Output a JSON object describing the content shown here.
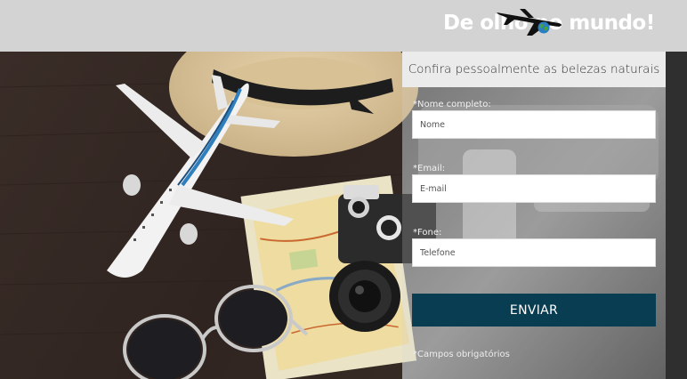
{
  "header": {
    "logo_text": "De olho no mundo!",
    "logo_icons": [
      "airplane-icon",
      "globe-icon"
    ],
    "background": "#d3d3d3"
  },
  "hero": {
    "image": "travel-flatlay-photo",
    "items": [
      "toy-airplane",
      "straw-hat",
      "map",
      "camera",
      "sunglasses"
    ]
  },
  "form": {
    "title": "Confira pessoalmente as belezas naturais",
    "fields": [
      {
        "label": "*Nome completo:",
        "placeholder": "Nome",
        "value": ""
      },
      {
        "label": "*Email:",
        "placeholder": "E-mail",
        "value": ""
      },
      {
        "label": "*Fone:",
        "placeholder": "Telefone",
        "value": ""
      }
    ],
    "submit_label": "ENVIAR",
    "required_note": "*Campos obrigatórios",
    "button_color": "#083d52"
  }
}
